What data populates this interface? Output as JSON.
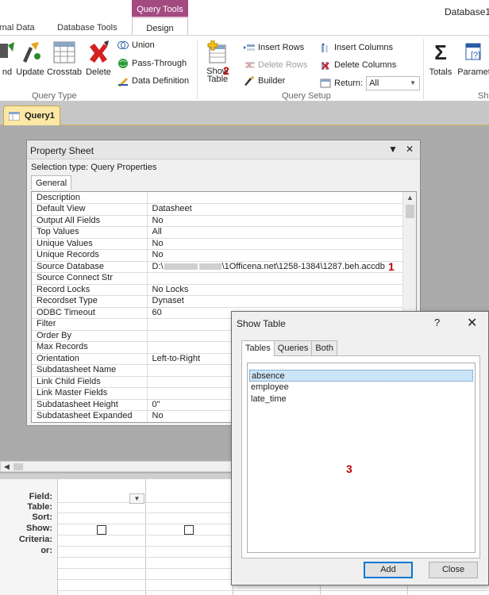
{
  "ribbon": {
    "tabs": {
      "external_data": "rnal Data",
      "database_tools": "Database Tools",
      "context_label": "Query Tools",
      "design": "Design"
    },
    "db_title": "Database1",
    "query_type": {
      "label": "Query Type",
      "append": "nd",
      "update": "Update",
      "crosstab": "Crosstab",
      "delete": "Delete",
      "union": "Union",
      "pass_through": "Pass-Through",
      "data_definition": "Data Definition"
    },
    "query_setup": {
      "label": "Query Setup",
      "show_table_line1": "Show",
      "show_table_line2": "Table",
      "insert_rows": "Insert Rows",
      "delete_rows": "Delete Rows",
      "builder": "Builder",
      "insert_columns": "Insert Columns",
      "delete_columns": "Delete Columns",
      "return_label": "Return:",
      "return_value": "All"
    },
    "show_hide": {
      "totals": "Totals",
      "parameters": "Paramet",
      "group_label": "Sh"
    }
  },
  "annotations": {
    "n1": "1",
    "n2": "2",
    "n3": "3"
  },
  "document_tab": {
    "label": "Query1"
  },
  "property_sheet": {
    "title": "Property Sheet",
    "selection_type": "Selection type:  Query Properties",
    "tab_general": "General",
    "rows": [
      {
        "key": "Description",
        "value": ""
      },
      {
        "key": "Default View",
        "value": "Datasheet"
      },
      {
        "key": "Output All Fields",
        "value": "No"
      },
      {
        "key": "Top Values",
        "value": "All"
      },
      {
        "key": "Unique Values",
        "value": "No"
      },
      {
        "key": "Unique Records",
        "value": "No"
      },
      {
        "key": "Source Database",
        "value_prefix": "D:\\",
        "value_suffix": "\\1Officena.net\\1258-1384\\1287.beh.accdb"
      },
      {
        "key": "Source Connect Str",
        "value": ""
      },
      {
        "key": "Record Locks",
        "value": "No Locks"
      },
      {
        "key": "Recordset Type",
        "value": "Dynaset"
      },
      {
        "key": "ODBC Timeout",
        "value": "60"
      },
      {
        "key": "Filter",
        "value": ""
      },
      {
        "key": "Order By",
        "value": ""
      },
      {
        "key": "Max Records",
        "value": ""
      },
      {
        "key": "Orientation",
        "value": "Left-to-Right"
      },
      {
        "key": "Subdatasheet Name",
        "value": ""
      },
      {
        "key": "Link Child Fields",
        "value": ""
      },
      {
        "key": "Link Master Fields",
        "value": ""
      },
      {
        "key": "Subdatasheet Height",
        "value": "0\""
      },
      {
        "key": "Subdatasheet Expanded",
        "value": "No"
      }
    ]
  },
  "qbe_grid": {
    "labels": {
      "field": "Field:",
      "table": "Table:",
      "sort": "Sort:",
      "show": "Show:",
      "criteria": "Criteria:",
      "or": "or:"
    }
  },
  "show_table": {
    "title": "Show Table",
    "help": "?",
    "close": "✕",
    "tabs": [
      "Tables",
      "Queries",
      "Both"
    ],
    "tables": [
      "absence",
      "employee",
      "late_time"
    ],
    "selected": "absence",
    "add_button": "Add",
    "close_button": "Close"
  },
  "colors": {
    "context_tab": "#a34a80",
    "doc_tab": "#fce7a4",
    "annotation_red": "#c00000",
    "selection": "#cce4f7"
  }
}
